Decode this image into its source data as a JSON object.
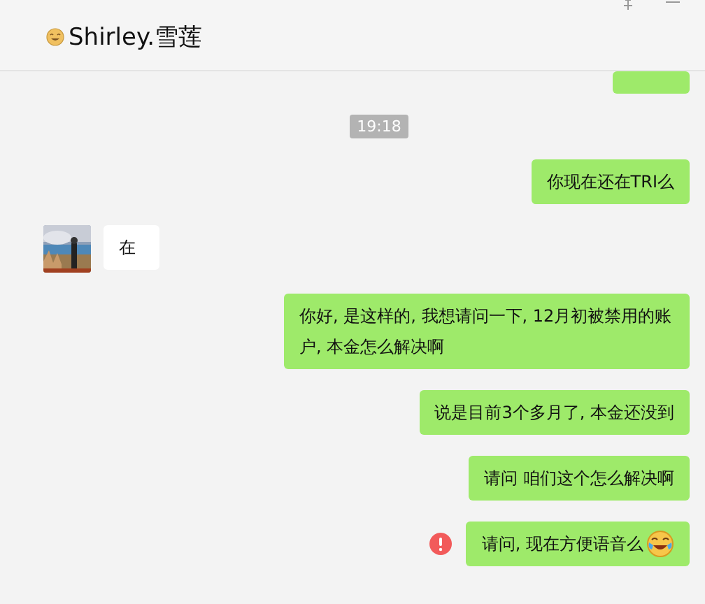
{
  "header": {
    "title": "Shirley.雪莲"
  },
  "messages": [
    {
      "kind": "cut_outgoing"
    },
    {
      "kind": "time",
      "text": "19:18"
    },
    {
      "kind": "outgoing",
      "text": "你现在还在TRI么",
      "failed": false,
      "emoji": false
    },
    {
      "kind": "incoming",
      "text": "在",
      "failed": false,
      "emoji": false
    },
    {
      "kind": "outgoing",
      "text": "你好, 是这样的, 我想请问一下, 12月初被禁用的账户, 本金怎么解决啊",
      "failed": false,
      "emoji": false
    },
    {
      "kind": "outgoing",
      "text": "说是目前3个多月了, 本金还没到",
      "failed": false,
      "emoji": false
    },
    {
      "kind": "outgoing",
      "text": "请问 咱们这个怎么解决啊",
      "failed": false,
      "emoji": false
    },
    {
      "kind": "outgoing",
      "text": "请问, 现在方便语音么",
      "failed": true,
      "emoji": true
    }
  ]
}
